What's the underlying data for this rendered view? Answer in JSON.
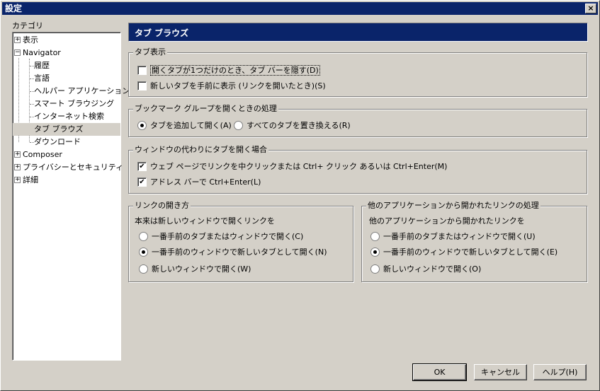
{
  "window": {
    "title": "設定",
    "close": "×"
  },
  "sidebar": {
    "label": "カテゴリ",
    "items": [
      {
        "label": "表示",
        "expander": "+"
      },
      {
        "label": "Navigator",
        "expander": "−"
      },
      {
        "label": "履歴"
      },
      {
        "label": "言語"
      },
      {
        "label": "ヘルパー アプリケーション"
      },
      {
        "label": "スマート ブラウジング"
      },
      {
        "label": "インターネット検索"
      },
      {
        "label": "タブ ブラウズ"
      },
      {
        "label": "ダウンロード"
      },
      {
        "label": "Composer",
        "expander": "+"
      },
      {
        "label": "プライバシーとセキュリティ",
        "expander": "+"
      },
      {
        "label": "詳細",
        "expander": "+"
      }
    ]
  },
  "panel": {
    "title": "タブ ブラウズ"
  },
  "tab_display": {
    "legend": "タブ表示",
    "option1": "開くタブが1つだけのとき、タブ バーを隠す(D)",
    "option2": "新しいタブを手前に表示 (リンクを開いたとき)(S)"
  },
  "bookmark_group": {
    "legend": "ブックマーク グループを開くときの処理",
    "option1": "タブを追加して開く(A)",
    "option2": "すべてのタブを置き換える(R)"
  },
  "open_in_tab": {
    "legend": "ウィンドウの代わりにタブを開く場合",
    "option1": "ウェブ ページでリンクを中クリックまたは Ctrl+ クリック あるいは Ctrl+Enter(M)",
    "option2": "アドレス バーで Ctrl+Enter(L)"
  },
  "link_open": {
    "legend": "リンクの開き方",
    "subtitle": "本来は新しいウィンドウで開くリンクを",
    "option1": "一番手前のタブまたはウィンドウで開く(C)",
    "option2": "一番手前のウィンドウで新しいタブとして開く(N)",
    "option3": "新しいウィンドウで開く(W)"
  },
  "external_link": {
    "legend": "他のアプリケーションから開かれたリンクの処理",
    "subtitle": "他のアプリケーションから開かれたリンクを",
    "option1": "一番手前のタブまたはウィンドウで開く(U)",
    "option2": "一番手前のウィンドウで新しいタブとして開く(E)",
    "option3": "新しいウィンドウで開く(O)"
  },
  "buttons": {
    "ok": "OK",
    "cancel": "キャンセル",
    "help": "ヘルプ(H)"
  }
}
